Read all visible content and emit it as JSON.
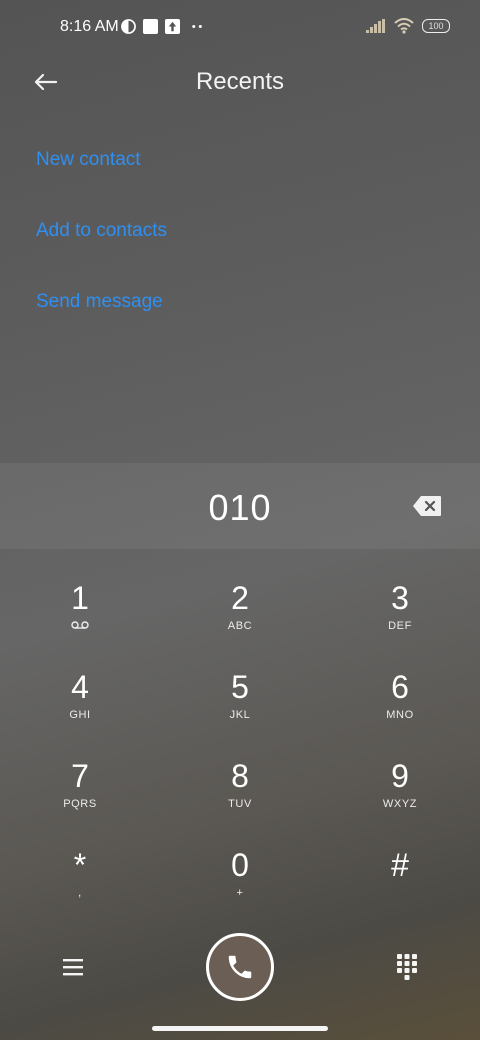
{
  "status_bar": {
    "time": "8:16 AM",
    "left_icons": [
      "brightness-icon",
      "square-notification-icon",
      "upload-icon",
      "more-dots-icon"
    ],
    "battery": "100"
  },
  "app_bar": {
    "title": "Recents",
    "back_icon": "back-arrow-icon"
  },
  "actions": [
    {
      "label": "New contact"
    },
    {
      "label": "Add to contacts"
    },
    {
      "label": "Send message"
    }
  ],
  "dialer": {
    "number": "010"
  },
  "keypad": [
    {
      "digit": "1",
      "letters": "",
      "sub_icon": "voicemail-icon"
    },
    {
      "digit": "2",
      "letters": "ABC"
    },
    {
      "digit": "3",
      "letters": "DEF"
    },
    {
      "digit": "4",
      "letters": "GHI"
    },
    {
      "digit": "5",
      "letters": "JKL"
    },
    {
      "digit": "6",
      "letters": "MNO"
    },
    {
      "digit": "7",
      "letters": "PQRS"
    },
    {
      "digit": "8",
      "letters": "TUV"
    },
    {
      "digit": "9",
      "letters": "WXYZ"
    },
    {
      "digit": "*",
      "letters": ","
    },
    {
      "digit": "0",
      "letters": "+"
    },
    {
      "digit": "#",
      "letters": ""
    }
  ],
  "colors": {
    "link": "#2f8ff2",
    "call_button_fill": "#6b5e55"
  }
}
